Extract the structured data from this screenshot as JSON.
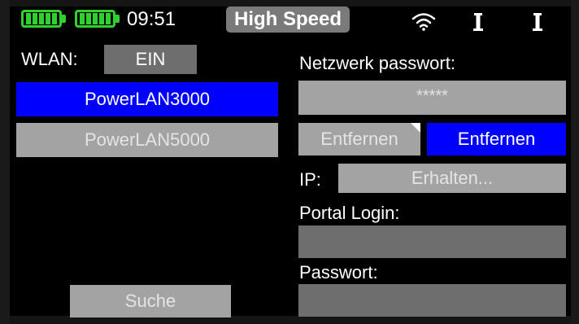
{
  "status_bar": {
    "time": "09:51",
    "mode": "High Speed",
    "battery_color": "#2fd12f",
    "icons": [
      "battery-icon",
      "battery-icon",
      "wifi-icon",
      "antenna-icon",
      "antenna-icon"
    ]
  },
  "wlan": {
    "label": "WLAN:",
    "toggle": "EIN",
    "networks": [
      {
        "name": "PowerLAN3000",
        "selected": true
      },
      {
        "name": "PowerLAN5000",
        "selected": false
      }
    ],
    "search_button": "Suche"
  },
  "settings": {
    "password_label": "Netzwerk passwort:",
    "password_value": "*****",
    "remove_button_1": "Entfernen",
    "remove_button_2": "Entfernen",
    "ip_label": "IP:",
    "ip_value": "Erhalten...",
    "portal_login_label": "Portal Login:",
    "portal_login_value": "",
    "portal_password_label": "Passwort:",
    "portal_password_value": ""
  },
  "colors": {
    "selected": "#0000ff",
    "button": "#a3a3a3",
    "field_empty": "#6e6e6e",
    "badge": "#7a7a7a"
  }
}
